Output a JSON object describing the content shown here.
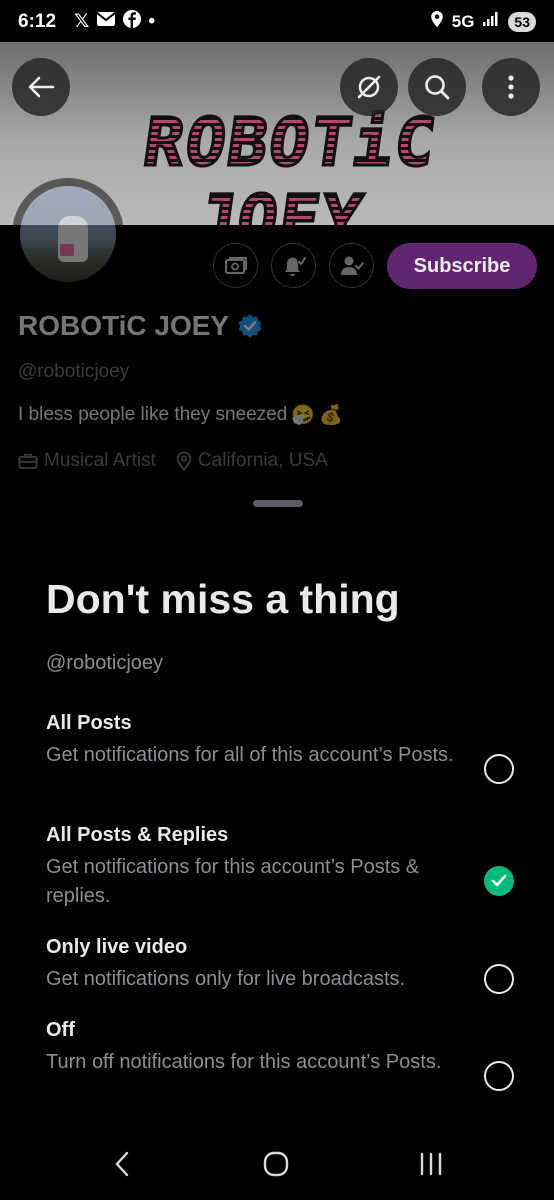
{
  "status_bar": {
    "time": "6:12",
    "left_icons": [
      "x-logo-icon",
      "mail-icon",
      "facebook-icon",
      "dot-icon"
    ],
    "network": "5G",
    "battery": "53"
  },
  "banner": {
    "title": "ROBOTiC JOEY"
  },
  "profile": {
    "display_name": "ROBOTiC JOEY",
    "handle": "@roboticjoey",
    "bio": "I bless people like they sneezed",
    "bio_emojis": [
      "🤧",
      "💰"
    ],
    "category": "Musical Artist",
    "location": "California, USA",
    "subscribe_label": "Subscribe"
  },
  "sheet": {
    "title": "Don't miss a thing",
    "handle": "@roboticjoey",
    "options": [
      {
        "title": "All Posts",
        "description": "Get notifications for all of this account’s Posts.",
        "selected": false
      },
      {
        "title": "All Posts & Replies",
        "description": "Get notifications for this account’s Posts & replies.",
        "selected": true
      },
      {
        "title": "Only live video",
        "description": "Get notifications only for live broadcasts.",
        "selected": false
      },
      {
        "title": "Off",
        "description": "Turn off notifications for this account’s Posts.",
        "selected": false
      }
    ]
  },
  "colors": {
    "background": "#000000",
    "subscribe": "#6a2a7a",
    "selected": "#00ba7c",
    "verified": "#1d9bf0",
    "secondary_text": "#71767b"
  }
}
